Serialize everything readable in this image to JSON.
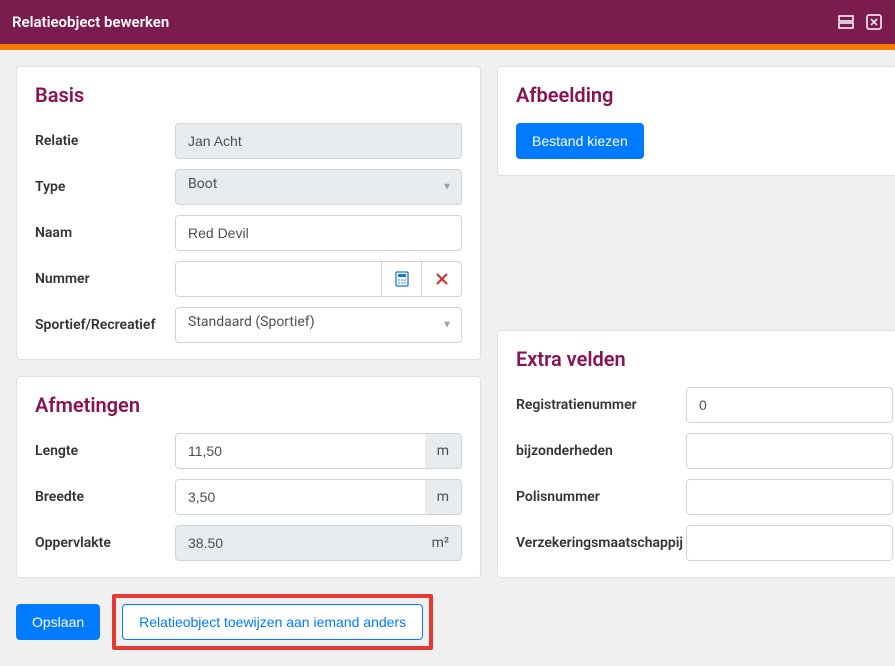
{
  "titlebar": {
    "title": "Relatieobject bewerken"
  },
  "basis": {
    "heading": "Basis",
    "relatie_label": "Relatie",
    "relatie_value": "Jan Acht",
    "type_label": "Type",
    "type_value": "Boot",
    "naam_label": "Naam",
    "naam_value": "Red Devil",
    "nummer_label": "Nummer",
    "nummer_value": "",
    "sportief_label": "Sportief/Recreatief",
    "sportief_value": "Standaard (Sportief)"
  },
  "afmetingen": {
    "heading": "Afmetingen",
    "lengte_label": "Lengte",
    "lengte_value": "11,50",
    "lengte_unit": "m",
    "breedte_label": "Breedte",
    "breedte_value": "3,50",
    "breedte_unit": "m",
    "oppervlakte_label": "Oppervlakte",
    "oppervlakte_value": "38.50",
    "oppervlakte_unit": "m²"
  },
  "afbeelding": {
    "heading": "Afbeelding",
    "button_label": "Bestand kiezen"
  },
  "extra": {
    "heading": "Extra velden",
    "registratie_label": "Registratienummer",
    "registratie_value": "0",
    "bijzonderheden_label": "bijzonderheden",
    "bijzonderheden_value": "",
    "polis_label": "Polisnummer",
    "polis_value": "",
    "verzekering_label": "Verzekeringsmaatschappij",
    "verzekering_value": ""
  },
  "footer": {
    "save_label": "Opslaan",
    "assign_label": "Relatieobject toewijzen aan iemand anders"
  }
}
